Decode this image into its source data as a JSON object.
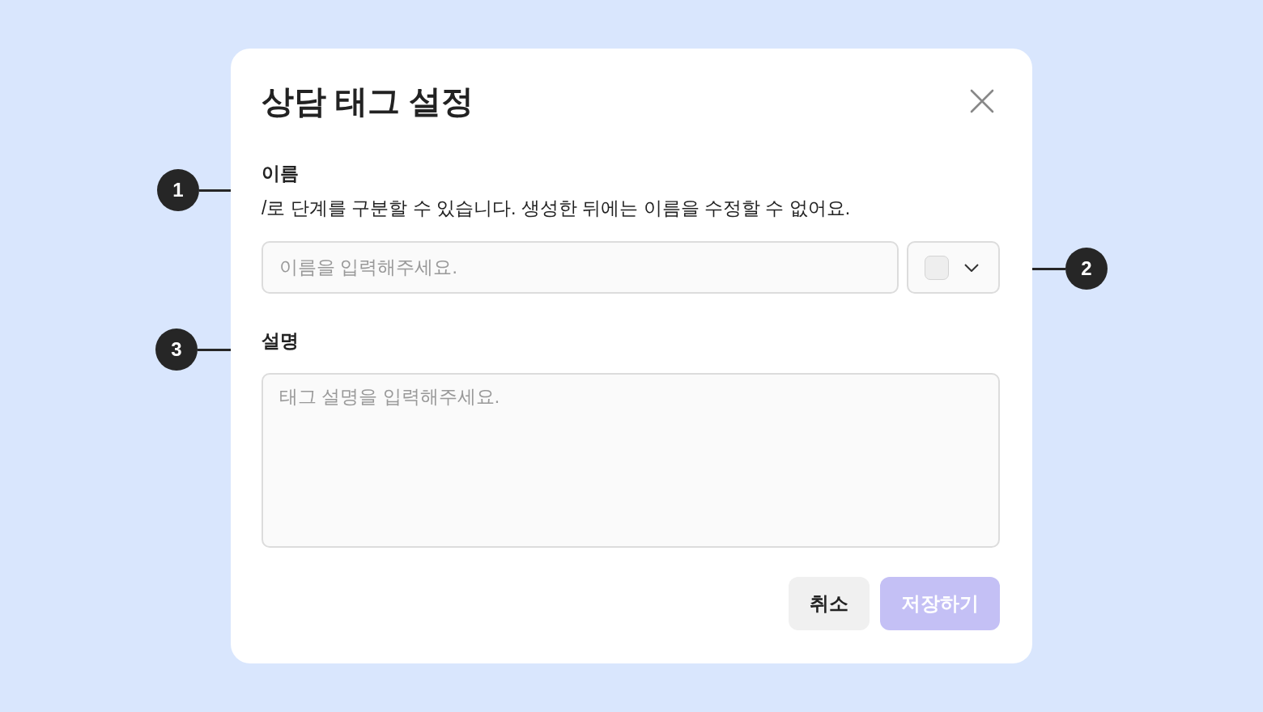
{
  "dialog": {
    "title": "상담 태그 설정",
    "name_field": {
      "label": "이름",
      "hint": "/로 단계를 구분할 수 있습니다. 생성한 뒤에는 이름을 수정할 수 없어요.",
      "placeholder": "이름을 입력해주세요."
    },
    "description_field": {
      "label": "설명",
      "placeholder": "태그 설명을 입력해주세요."
    },
    "buttons": [
      {
        "label": "취소",
        "kind": "secondary",
        "disabled": false
      },
      {
        "label": "저장하기",
        "kind": "primary",
        "disabled": true
      }
    ]
  },
  "markers": [
    {
      "label": "1",
      "kind": "left"
    },
    {
      "label": "2",
      "kind": "right"
    },
    {
      "label": "3",
      "kind": "left"
    }
  ]
}
